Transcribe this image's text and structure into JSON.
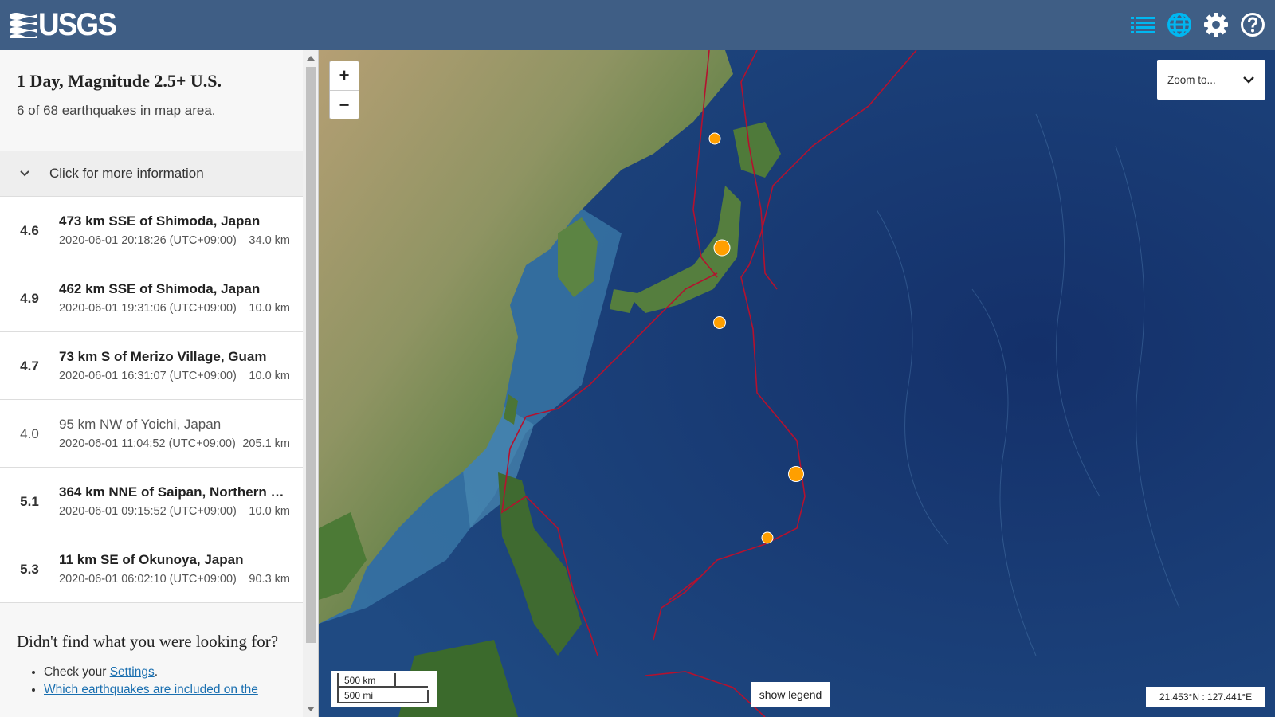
{
  "header": {
    "logo": "USGS",
    "icons": [
      "list-icon",
      "globe-icon",
      "gear-icon",
      "help-icon"
    ],
    "accent": "#00b7f1",
    "background": "#3f5e85"
  },
  "sidebar": {
    "title": "1 Day, Magnitude 2.5+ U.S.",
    "count_text": "6 of 68 earthquakes in map area.",
    "more_info": "Click for more information",
    "earthquakes": [
      {
        "mag": "4.6",
        "place": "473 km SSE of Shimoda, Japan",
        "time": "2020-06-01 20:18:26 (UTC+09:00)",
        "depth": "34.0 km"
      },
      {
        "mag": "4.9",
        "place": "462 km SSE of Shimoda, Japan",
        "time": "2020-06-01 19:31:06 (UTC+09:00)",
        "depth": "10.0 km"
      },
      {
        "mag": "4.7",
        "place": "73 km S of Merizo Village, Guam",
        "time": "2020-06-01 16:31:07 (UTC+09:00)",
        "depth": "10.0 km"
      },
      {
        "mag": "4.0",
        "place": "95 km NW of Yoichi, Japan",
        "time": "2020-06-01 11:04:52 (UTC+09:00)",
        "depth": "205.1 km"
      },
      {
        "mag": "5.1",
        "place": "364 km NNE of Saipan, Northern …",
        "time": "2020-06-01 09:15:52 (UTC+09:00)",
        "depth": "10.0 km"
      },
      {
        "mag": "5.3",
        "place": "11 km SE of Okunoya, Japan",
        "time": "2020-06-01 06:02:10 (UTC+09:00)",
        "depth": "90.3 km"
      }
    ],
    "help_title": "Didn't find what you were looking for?",
    "help_item1_prefix": "Check your ",
    "help_item1_link": "Settings",
    "help_item1_suffix": ".",
    "help_item2_link": "Which earthquakes are included on the"
  },
  "map": {
    "zoom_in": "+",
    "zoom_out": "−",
    "zoom_to": "Zoom to...",
    "scale_km": "500 km",
    "scale_mi": "500 mi",
    "show_legend": "show legend",
    "coords": "21.453°N : 127.441°E",
    "marker_color": "#ff9f00",
    "plate_boundary_color": "#b5112e"
  }
}
